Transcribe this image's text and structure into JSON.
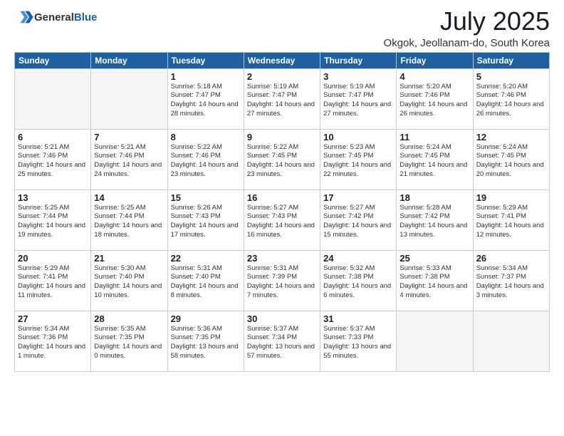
{
  "header": {
    "logo_general": "General",
    "logo_blue": "Blue",
    "month_year": "July 2025",
    "location": "Okgok, Jeollanam-do, South Korea"
  },
  "weekdays": [
    "Sunday",
    "Monday",
    "Tuesday",
    "Wednesday",
    "Thursday",
    "Friday",
    "Saturday"
  ],
  "weeks": [
    [
      {
        "day": "",
        "info": ""
      },
      {
        "day": "",
        "info": ""
      },
      {
        "day": "1",
        "info": "Sunrise: 5:18 AM\nSunset: 7:47 PM\nDaylight: 14 hours and 28 minutes."
      },
      {
        "day": "2",
        "info": "Sunrise: 5:19 AM\nSunset: 7:47 PM\nDaylight: 14 hours and 27 minutes."
      },
      {
        "day": "3",
        "info": "Sunrise: 5:19 AM\nSunset: 7:47 PM\nDaylight: 14 hours and 27 minutes."
      },
      {
        "day": "4",
        "info": "Sunrise: 5:20 AM\nSunset: 7:46 PM\nDaylight: 14 hours and 26 minutes."
      },
      {
        "day": "5",
        "info": "Sunrise: 5:20 AM\nSunset: 7:46 PM\nDaylight: 14 hours and 26 minutes."
      }
    ],
    [
      {
        "day": "6",
        "info": "Sunrise: 5:21 AM\nSunset: 7:46 PM\nDaylight: 14 hours and 25 minutes."
      },
      {
        "day": "7",
        "info": "Sunrise: 5:21 AM\nSunset: 7:46 PM\nDaylight: 14 hours and 24 minutes."
      },
      {
        "day": "8",
        "info": "Sunrise: 5:22 AM\nSunset: 7:46 PM\nDaylight: 14 hours and 23 minutes."
      },
      {
        "day": "9",
        "info": "Sunrise: 5:22 AM\nSunset: 7:45 PM\nDaylight: 14 hours and 23 minutes."
      },
      {
        "day": "10",
        "info": "Sunrise: 5:23 AM\nSunset: 7:45 PM\nDaylight: 14 hours and 22 minutes."
      },
      {
        "day": "11",
        "info": "Sunrise: 5:24 AM\nSunset: 7:45 PM\nDaylight: 14 hours and 21 minutes."
      },
      {
        "day": "12",
        "info": "Sunrise: 5:24 AM\nSunset: 7:45 PM\nDaylight: 14 hours and 20 minutes."
      }
    ],
    [
      {
        "day": "13",
        "info": "Sunrise: 5:25 AM\nSunset: 7:44 PM\nDaylight: 14 hours and 19 minutes."
      },
      {
        "day": "14",
        "info": "Sunrise: 5:25 AM\nSunset: 7:44 PM\nDaylight: 14 hours and 18 minutes."
      },
      {
        "day": "15",
        "info": "Sunrise: 5:26 AM\nSunset: 7:43 PM\nDaylight: 14 hours and 17 minutes."
      },
      {
        "day": "16",
        "info": "Sunrise: 5:27 AM\nSunset: 7:43 PM\nDaylight: 14 hours and 16 minutes."
      },
      {
        "day": "17",
        "info": "Sunrise: 5:27 AM\nSunset: 7:42 PM\nDaylight: 14 hours and 15 minutes."
      },
      {
        "day": "18",
        "info": "Sunrise: 5:28 AM\nSunset: 7:42 PM\nDaylight: 14 hours and 13 minutes."
      },
      {
        "day": "19",
        "info": "Sunrise: 5:29 AM\nSunset: 7:41 PM\nDaylight: 14 hours and 12 minutes."
      }
    ],
    [
      {
        "day": "20",
        "info": "Sunrise: 5:29 AM\nSunset: 7:41 PM\nDaylight: 14 hours and 11 minutes."
      },
      {
        "day": "21",
        "info": "Sunrise: 5:30 AM\nSunset: 7:40 PM\nDaylight: 14 hours and 10 minutes."
      },
      {
        "day": "22",
        "info": "Sunrise: 5:31 AM\nSunset: 7:40 PM\nDaylight: 14 hours and 8 minutes."
      },
      {
        "day": "23",
        "info": "Sunrise: 5:31 AM\nSunset: 7:39 PM\nDaylight: 14 hours and 7 minutes."
      },
      {
        "day": "24",
        "info": "Sunrise: 5:32 AM\nSunset: 7:38 PM\nDaylight: 14 hours and 6 minutes."
      },
      {
        "day": "25",
        "info": "Sunrise: 5:33 AM\nSunset: 7:38 PM\nDaylight: 14 hours and 4 minutes."
      },
      {
        "day": "26",
        "info": "Sunrise: 5:34 AM\nSunset: 7:37 PM\nDaylight: 14 hours and 3 minutes."
      }
    ],
    [
      {
        "day": "27",
        "info": "Sunrise: 5:34 AM\nSunset: 7:36 PM\nDaylight: 14 hours and 1 minute."
      },
      {
        "day": "28",
        "info": "Sunrise: 5:35 AM\nSunset: 7:35 PM\nDaylight: 14 hours and 0 minutes."
      },
      {
        "day": "29",
        "info": "Sunrise: 5:36 AM\nSunset: 7:35 PM\nDaylight: 13 hours and 58 minutes."
      },
      {
        "day": "30",
        "info": "Sunrise: 5:37 AM\nSunset: 7:34 PM\nDaylight: 13 hours and 57 minutes."
      },
      {
        "day": "31",
        "info": "Sunrise: 5:37 AM\nSunset: 7:33 PM\nDaylight: 13 hours and 55 minutes."
      },
      {
        "day": "",
        "info": ""
      },
      {
        "day": "",
        "info": ""
      }
    ]
  ]
}
